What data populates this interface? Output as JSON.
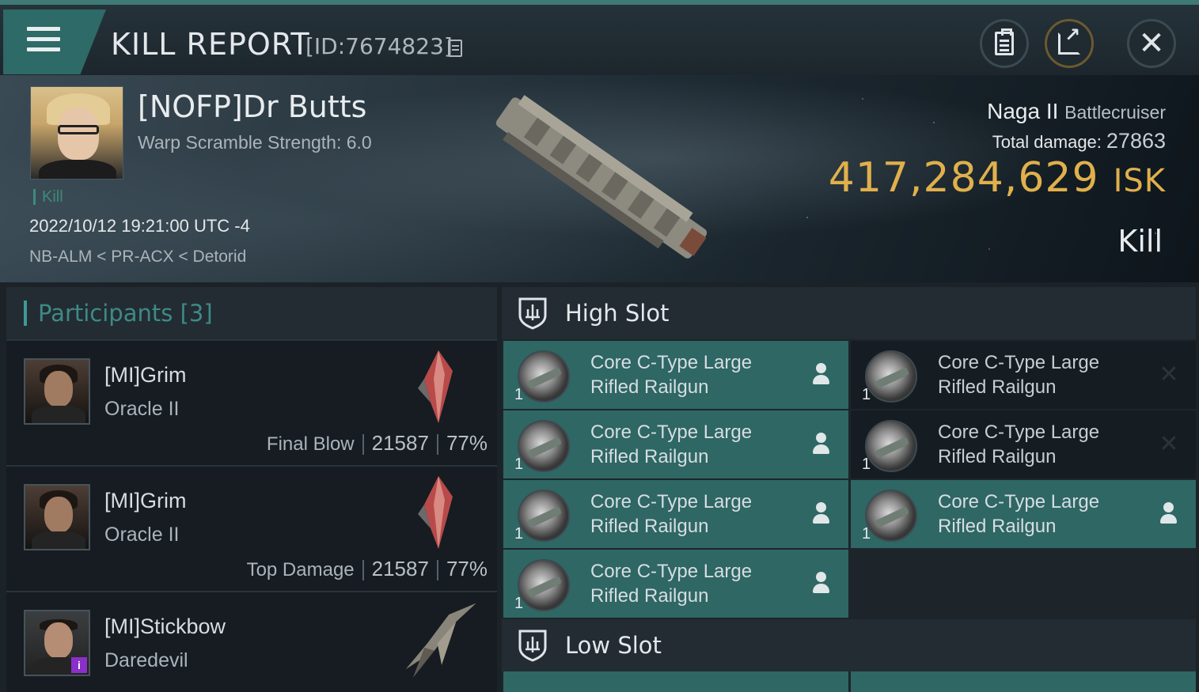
{
  "header": {
    "title": "KILL REPORT",
    "id_label": "[ID:7674823]"
  },
  "victim": {
    "name": "[NOFP]Dr Butts",
    "warp_scramble": "Warp Scramble Strength: 6.0",
    "kill_tag": "Kill",
    "datetime": "2022/10/12 19:21:00 UTC -4",
    "location": "NB-ALM < PR-ACX < Detorid",
    "ship_name": "Naga II",
    "ship_class": "Battlecruiser",
    "total_damage_label": "Total damage:",
    "total_damage_value": "27863",
    "isk_value": "417,284,629",
    "isk_unit": "ISK",
    "result": "Kill"
  },
  "participants": {
    "title": "Participants [3]",
    "rows": [
      {
        "name": "[MI]Grim",
        "ship": "Oracle II",
        "label": "Final Blow",
        "damage": "21587",
        "percent": "77%"
      },
      {
        "name": "[MI]Grim",
        "ship": "Oracle II",
        "label": "Top Damage",
        "damage": "21587",
        "percent": "77%"
      },
      {
        "name": "[MI]Stickbow",
        "ship": "Daredevil",
        "badge": "i"
      }
    ]
  },
  "slots": {
    "high_title": "High Slot",
    "low_title": "Low Slot",
    "high_modules": [
      {
        "name_line1": "Core C-Type Large",
        "name_line2": "Rifled Railgun",
        "qty": "1",
        "status": "fitted"
      },
      {
        "name_line1": "Core C-Type Large",
        "name_line2": "Rifled Railgun",
        "qty": "1",
        "status": "destroyed"
      },
      {
        "name_line1": "Core C-Type Large",
        "name_line2": "Rifled Railgun",
        "qty": "1",
        "status": "fitted"
      },
      {
        "name_line1": "Core C-Type Large",
        "name_line2": "Rifled Railgun",
        "qty": "1",
        "status": "destroyed"
      },
      {
        "name_line1": "Core C-Type Large",
        "name_line2": "Rifled Railgun",
        "qty": "1",
        "status": "fitted"
      },
      {
        "name_line1": "Core C-Type Large",
        "name_line2": "Rifled Railgun",
        "qty": "1",
        "status": "fitted"
      },
      {
        "name_line1": "Core C-Type Large",
        "name_line2": "Rifled Railgun",
        "qty": "1",
        "status": "fitted"
      }
    ]
  },
  "colors": {
    "accent_teal": "#2e6764",
    "isk_gold": "#e0b04c",
    "kill_green": "#3e8a7a"
  },
  "icons": {
    "menu": "hamburger-icon",
    "report": "clipboard-icon",
    "share": "share-icon",
    "close": "close-icon",
    "copy": "copy-icon",
    "slot": "shield-icon",
    "pilot": "person-icon",
    "destroyed": "x-icon"
  }
}
